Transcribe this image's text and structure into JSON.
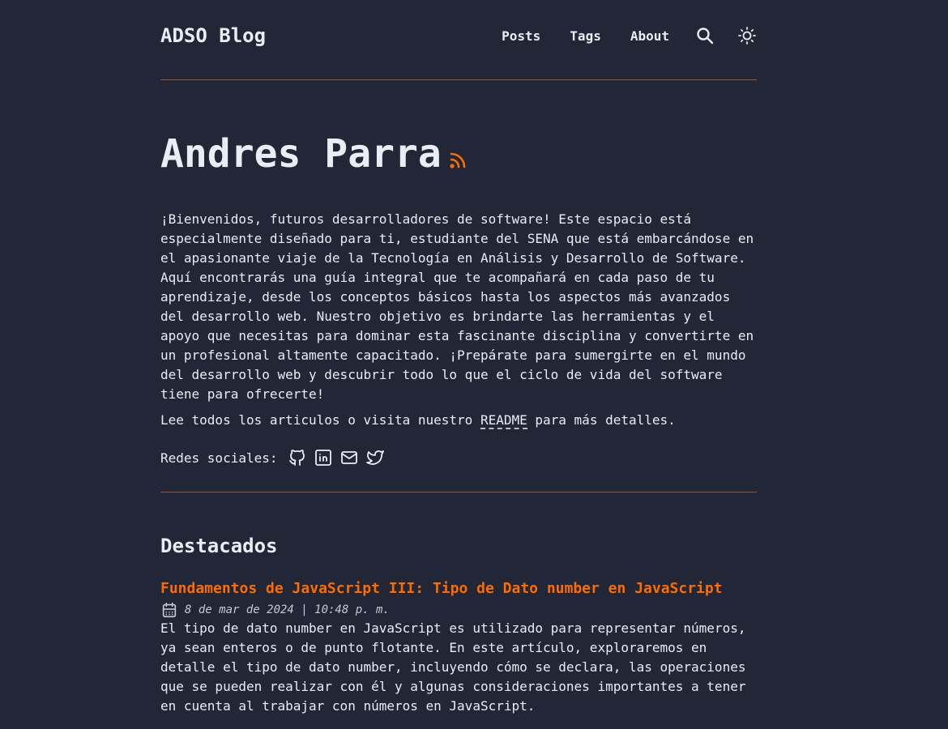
{
  "header": {
    "brand": "ADSO Blog",
    "nav": {
      "posts": "Posts",
      "tags": "Tags",
      "about": "About"
    }
  },
  "hero": {
    "title": "Andres Parra",
    "intro": "¡Bienvenidos, futuros desarrolladores de software! Este espacio está especialmente diseñado para ti, estudiante del SENA que está embarcándose en el apasionante viaje de la Tecnología en Análisis y Desarrollo de Software. Aquí encontrarás una guía integral que te acompañará en cada paso de tu aprendizaje, desde los conceptos básicos hasta los aspectos más avanzados del desarrollo web. Nuestro objetivo es brindarte las herramientas y el apoyo que necesitas para dominar esta fascinante disciplina y convertirte en un profesional altamente capacitado. ¡Prepárate para sumergirte en el mundo del desarrollo web y descubrir todo lo que el ciclo de vida del software tiene para ofrecerte!",
    "readme_prefix": "Lee todos los articulos o visita nuestro ",
    "readme_link": "README",
    "readme_suffix": " para más detalles.",
    "social_label": "Redes sociales:"
  },
  "featured": {
    "heading": "Destacados",
    "posts": [
      {
        "title": "Fundamentos de JavaScript III: Tipo de Dato number en JavaScript",
        "date": "8 de mar de 2024 | 10:48 p. m.",
        "description": "El tipo de dato number en JavaScript es utilizado para representar números, ya sean enteros o de punto flotante. En este artículo, exploraremos en detalle el tipo de dato number, incluyendo cómo se declara, las operaciones que se pueden realizar con él y algunas consideraciones importantes a tener en cuenta al trabajar con números en JavaScript."
      }
    ]
  },
  "icons": {
    "search": "search-icon",
    "theme": "sun-icon",
    "rss": "rss-icon",
    "github": "github-icon",
    "linkedin": "linkedin-icon",
    "mail": "mail-icon",
    "twitter": "twitter-icon",
    "calendar": "calendar-icon"
  },
  "colors": {
    "background": "#212737",
    "text": "#eaedf3",
    "accent": "#ff6b01",
    "divider": "#a0522d"
  }
}
